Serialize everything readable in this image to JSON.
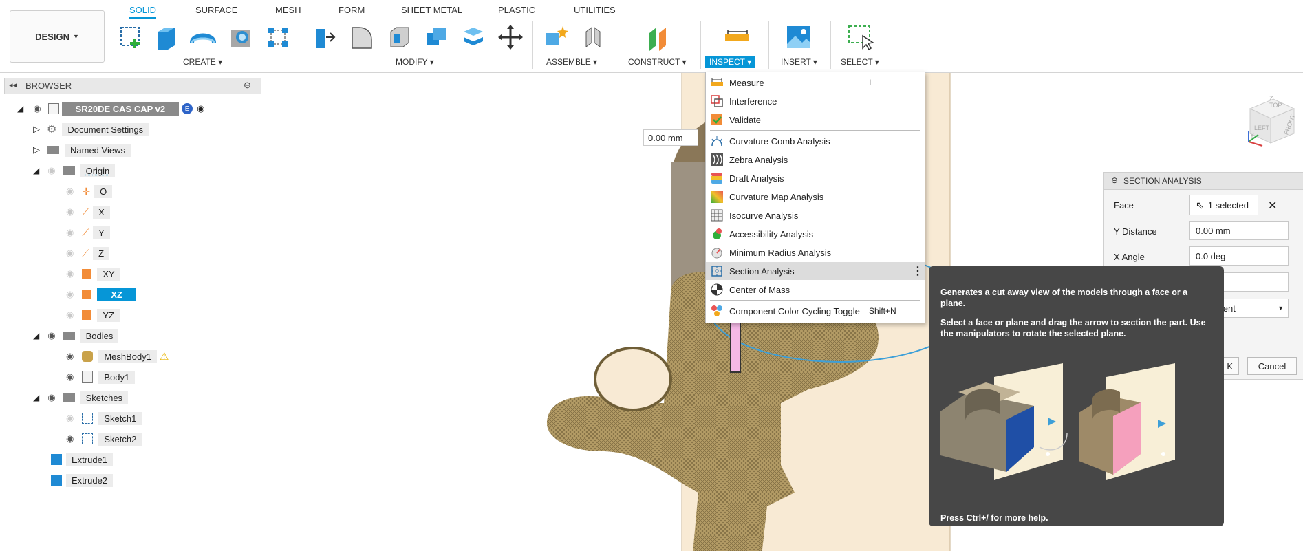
{
  "toolbar": {
    "design_label": "DESIGN",
    "tabs": [
      "SOLID",
      "SURFACE",
      "MESH",
      "FORM",
      "SHEET METAL",
      "PLASTIC",
      "UTILITIES"
    ],
    "groups": {
      "create": "CREATE",
      "modify": "MODIFY",
      "assemble": "ASSEMBLE",
      "construct": "CONSTRUCT",
      "inspect": "INSPECT",
      "insert": "INSERT",
      "select": "SELECT"
    },
    "accent": "#0696d7"
  },
  "browser": {
    "title": "BROWSER",
    "root": "SR20DE CAS CAP v2",
    "items": {
      "document_settings": "Document Settings",
      "named_views": "Named Views",
      "origin": "Origin",
      "o": "O",
      "x": "X",
      "y": "Y",
      "z": "Z",
      "xy": "XY",
      "xz": "XZ",
      "yz": "YZ",
      "bodies": "Bodies",
      "meshbody1": "MeshBody1",
      "body1": "Body1",
      "sketches": "Sketches",
      "sketch1": "Sketch1",
      "sketch2": "Sketch2",
      "extrude1": "Extrude1",
      "extrude2": "Extrude2"
    }
  },
  "viewport": {
    "distance_value": "0.00 mm"
  },
  "inspect_menu": {
    "items": [
      {
        "label": "Measure",
        "shortcut": "I"
      },
      {
        "label": "Interference",
        "shortcut": ""
      },
      {
        "label": "Validate",
        "shortcut": ""
      },
      {
        "label": "Curvature Comb Analysis",
        "shortcut": ""
      },
      {
        "label": "Zebra Analysis",
        "shortcut": ""
      },
      {
        "label": "Draft Analysis",
        "shortcut": ""
      },
      {
        "label": "Curvature Map Analysis",
        "shortcut": ""
      },
      {
        "label": "Isocurve Analysis",
        "shortcut": ""
      },
      {
        "label": "Accessibility Analysis",
        "shortcut": ""
      },
      {
        "label": "Minimum Radius Analysis",
        "shortcut": ""
      },
      {
        "label": "Section Analysis",
        "shortcut": ""
      },
      {
        "label": "Center of Mass",
        "shortcut": ""
      },
      {
        "label": "Component Color Cycling Toggle",
        "shortcut": "Shift+N"
      }
    ]
  },
  "section_analysis": {
    "title": "SECTION ANALYSIS",
    "face_label": "Face",
    "face_value": "1 selected",
    "ydist_label": "Y Distance",
    "ydist_value": "0.00 mm",
    "xangle_label": "X Angle",
    "xangle_value": "0.0 deg",
    "component_value": "omponent",
    "ok_label": "K",
    "cancel_label": "Cancel"
  },
  "tooltip": {
    "line1": "Generates a cut away view of the models through a face or a plane.",
    "line2": "Select a face or plane and drag the arrow to section the part. Use the manipulators to rotate the selected plane.",
    "footer": "Press Ctrl+/ for more help."
  },
  "viewcube": {
    "left": "LEFT",
    "front": "FRONT",
    "top": "TOP",
    "y": "Y",
    "z": "Z"
  }
}
